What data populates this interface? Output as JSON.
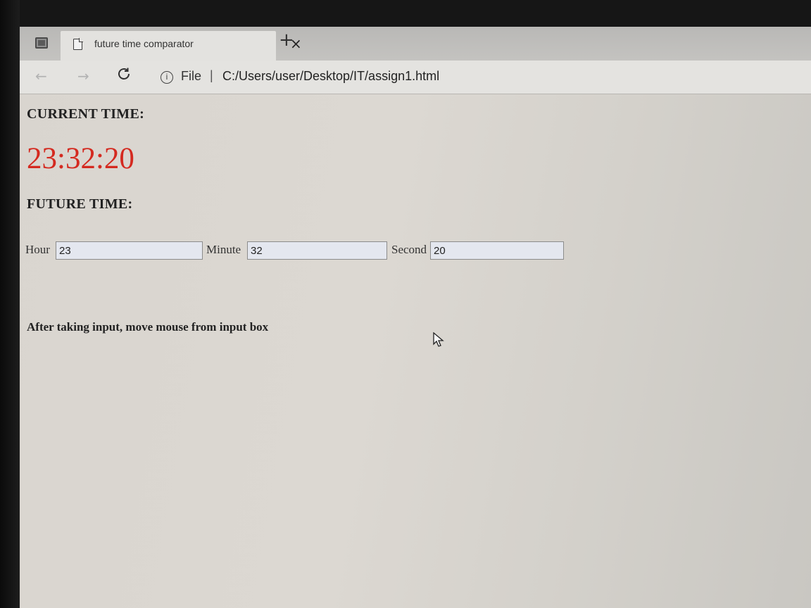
{
  "browser": {
    "tab_title": "future time comparator",
    "tab_close": "×",
    "new_tab": "+",
    "back": "←",
    "forward": "→",
    "reload": "C",
    "info": "i",
    "url_scheme": "File",
    "url_separator": "|",
    "url_path": "C:/Users/user/Desktop/IT/assign1.html"
  },
  "page": {
    "current_heading": "CURRENT TIME:",
    "current_time": "23:32:20",
    "future_heading": "FUTURE TIME:",
    "hour_label": "Hour",
    "hour_value": "23",
    "minute_label": "Minute",
    "minute_value": "32",
    "second_label": "Second",
    "second_value": "20",
    "instruction": "After taking input, move mouse from input box",
    "clock_color": "#d42a20"
  }
}
